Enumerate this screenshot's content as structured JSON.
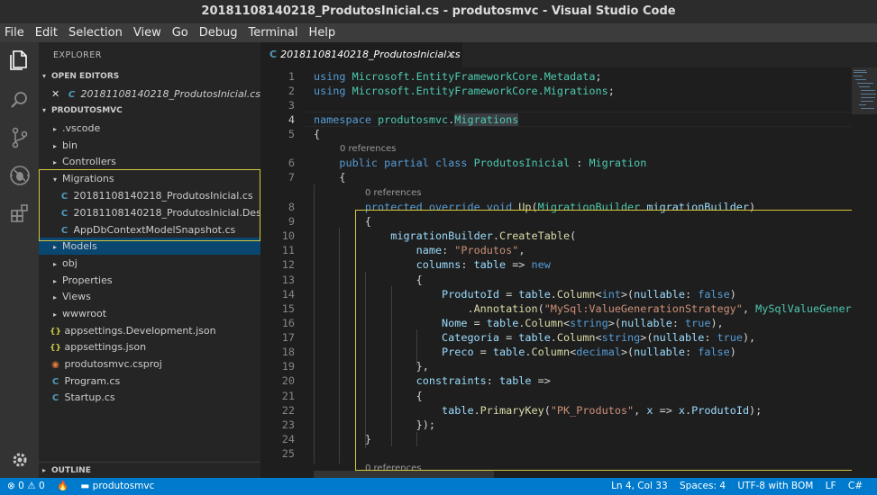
{
  "window": {
    "title": "20181108140218_ProdutosInicial.cs - produtosmvc - Visual Studio Code"
  },
  "menu": [
    "File",
    "Edit",
    "Selection",
    "View",
    "Go",
    "Debug",
    "Terminal",
    "Help"
  ],
  "activity_bar": [
    "files-icon",
    "search-icon",
    "source-control-icon",
    "debug-icon",
    "extensions-icon",
    "settings-gear-icon"
  ],
  "sidebar": {
    "title": "EXPLORER",
    "open_editors_label": "OPEN EDITORS",
    "open_editor_item": "20181108140218_ProdutosInicial.cs ...",
    "project_label": "PRODUTOSMVC",
    "tree": [
      {
        "label": ".vscode",
        "type": "folder",
        "expanded": false
      },
      {
        "label": "bin",
        "type": "folder",
        "expanded": false
      },
      {
        "label": "Controllers",
        "type": "folder",
        "expanded": false
      },
      {
        "label": "Migrations",
        "type": "folder",
        "expanded": true
      },
      {
        "label": "20181108140218_ProdutosInicial.cs",
        "type": "cs"
      },
      {
        "label": "20181108140218_ProdutosInicial.Desi...",
        "type": "cs"
      },
      {
        "label": "AppDbContextModelSnapshot.cs",
        "type": "cs"
      },
      {
        "label": "Models",
        "type": "folder",
        "expanded": false,
        "selected": true
      },
      {
        "label": "obj",
        "type": "folder",
        "expanded": false
      },
      {
        "label": "Properties",
        "type": "folder",
        "expanded": false
      },
      {
        "label": "Views",
        "type": "folder",
        "expanded": false
      },
      {
        "label": "wwwroot",
        "type": "folder",
        "expanded": false
      },
      {
        "label": "appsettings.Development.json",
        "type": "json"
      },
      {
        "label": "appsettings.json",
        "type": "json"
      },
      {
        "label": "produtosmvc.csproj",
        "type": "rss"
      },
      {
        "label": "Program.cs",
        "type": "cs"
      },
      {
        "label": "Startup.cs",
        "type": "cs"
      }
    ],
    "outline_label": "OUTLINE"
  },
  "editor": {
    "tab_label": "20181108140218_ProdutosInicial.cs",
    "line_numbers": [
      "1",
      "2",
      "3",
      "4",
      "5",
      "6",
      "7",
      "8",
      "9",
      "10",
      "11",
      "12",
      "13",
      "14",
      "15",
      "16",
      "17",
      "18",
      "19",
      "20",
      "21",
      "22",
      "23",
      "24",
      "25"
    ],
    "references_label": "0 references"
  },
  "status": {
    "errors": "0",
    "warnings": "0",
    "project": "produtosmvc",
    "position": "Ln 4, Col 33",
    "spaces": "Spaces: 4",
    "encoding": "UTF-8 with BOM",
    "eol": "LF",
    "language": "C#"
  },
  "colors": {
    "accent": "#007acc",
    "highlight_box": "#d8c53a",
    "selection": "#094771"
  }
}
